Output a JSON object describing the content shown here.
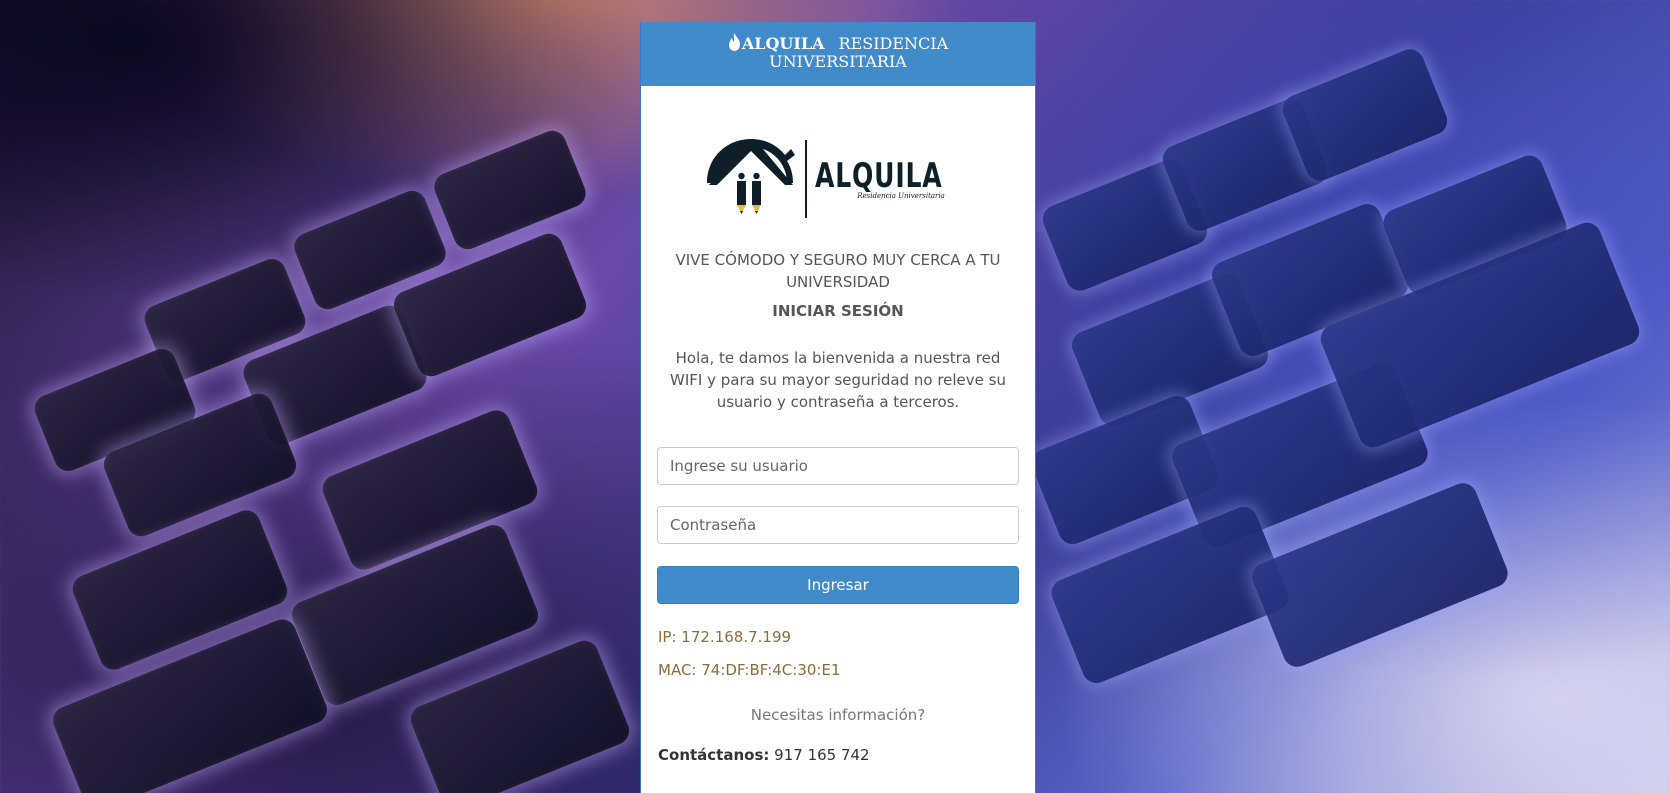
{
  "header": {
    "brand": "ALQUILA",
    "title_line1": "RESIDENCIA",
    "title_line2": "UNIVERSITARIA"
  },
  "logo": {
    "wordmark": "ALQUILA",
    "subtitle": "Residencia Universitaria",
    "colors": {
      "navy": "#0f1f2a",
      "pencil": "#f2b632"
    }
  },
  "tagline": "VIVE CÓMODO Y SEGURO MUY CERCA A TU UNIVERSIDAD",
  "login_title": "INICIAR SESIÓN",
  "welcome_text": "Hola, te damos la bienvenida a nuestra red WIFI y para su mayor seguridad no releve su usuario y contraseña a terceros.",
  "form": {
    "username_placeholder": "Ingrese su usuario",
    "password_placeholder": "Contraseña",
    "submit_label": "Ingresar"
  },
  "network": {
    "ip": "IP: 172.168.7.199",
    "mac": "MAC: 74:DF:BF:4C:30:E1"
  },
  "help_text": "Necesitas información?",
  "contact": {
    "label": "Contáctanos:",
    "phone": "917 165 742"
  },
  "colors": {
    "primary": "#428bca",
    "info_text": "#8a6d3b"
  }
}
